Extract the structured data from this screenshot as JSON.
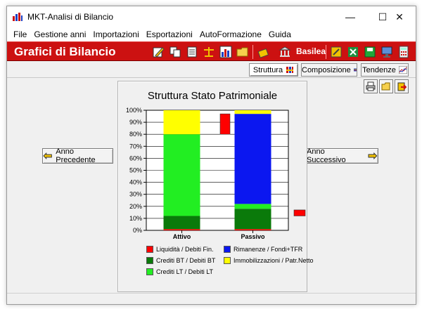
{
  "window": {
    "title": "MKT-Analisi di Bilancio",
    "controls": {
      "minimize": "—",
      "maximize": "☐",
      "close": "✕"
    }
  },
  "menu": [
    "File",
    "Gestione anni",
    "Importazioni",
    "Esportazioni",
    "AutoFormazione",
    "Guida"
  ],
  "header": {
    "title": "Grafici di Bilancio",
    "basilea_label": "Basilea",
    "toolbar_icons": [
      "edit-icon",
      "copy-icon",
      "list-icon",
      "balance-icon",
      "bar-chart-icon",
      "folder-icon",
      "chart-tag-icon",
      "basilea-icon",
      "note-icon",
      "excel-icon",
      "save-icon",
      "monitor-icon",
      "calculator-icon"
    ]
  },
  "tabs": [
    {
      "label": "Struttura",
      "active": true
    },
    {
      "label": "Composizione",
      "active": false
    },
    {
      "label": "Tendenze",
      "active": false
    }
  ],
  "nav": {
    "prev_label": "Anno Precedente",
    "next_label": "Anno Successivo"
  },
  "colors": {
    "red": "#ff0000",
    "dark_green": "#0a7a0a",
    "light_green": "#22ee22",
    "blue": "#0b17f0",
    "yellow": "#ffff00"
  },
  "chart_data": {
    "type": "bar",
    "stacked": true,
    "title": "Struttura Stato Patrimoniale",
    "categories": [
      "Attivo",
      "Passivo"
    ],
    "ylim": [
      0,
      100
    ],
    "yticks": [
      "0%",
      "10%",
      "20%",
      "30%",
      "40%",
      "50%",
      "60%",
      "70%",
      "80%",
      "90%",
      "100%"
    ],
    "series": [
      {
        "name": "Liquidità / Debiti Fin.",
        "color": "#ff0000",
        "values": [
          1,
          1
        ]
      },
      {
        "name": "Crediti BT / Debiti BT",
        "color": "#0a7a0a",
        "values": [
          11,
          17
        ]
      },
      {
        "name": "Crediti LT / Debiti LT",
        "color": "#22ee22",
        "values": [
          68,
          4
        ]
      },
      {
        "name": "Rimanenze / Fondi+TFR",
        "color": "#0b17f0",
        "values": [
          0,
          75
        ]
      },
      {
        "name": "Immobilizzazioni / Patr.Netto",
        "color": "#ffff00",
        "values": [
          20,
          3
        ]
      }
    ],
    "markers": [
      {
        "color": "#ff0000",
        "from": 80,
        "to": 97
      },
      {
        "color": "#ff0000",
        "from": 12,
        "to": 17
      }
    ],
    "grid": true
  }
}
